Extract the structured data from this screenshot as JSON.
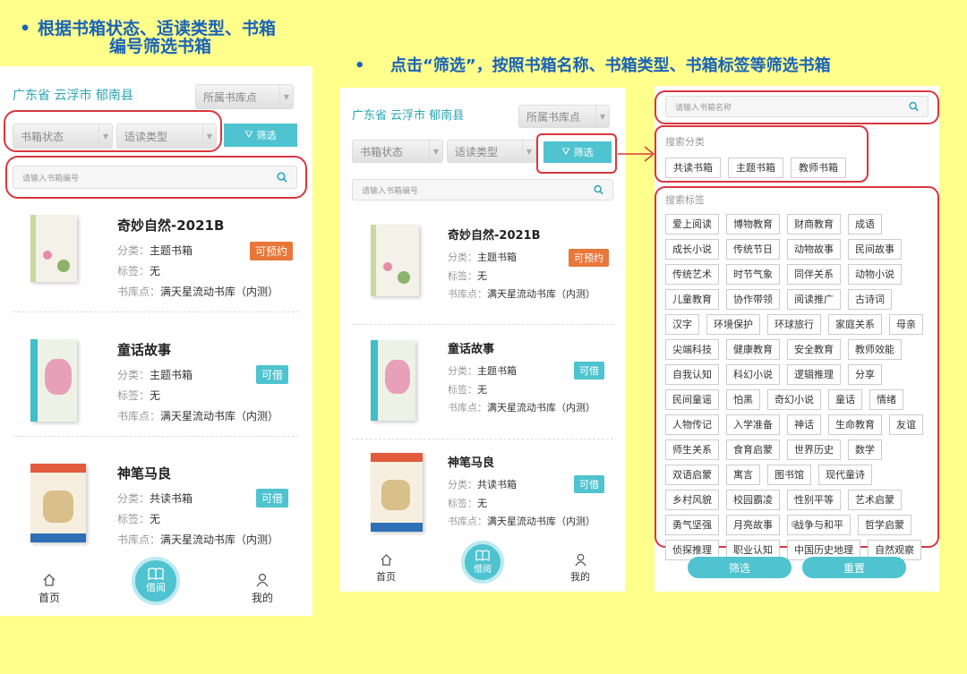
{
  "caption_left": [
    "根据书箱状态、适读类型、书箱",
    "编号筛选书箱"
  ],
  "caption_right": "点击“筛选”，按照书箱名称、书箱类型、书箱标签等筛选书箱",
  "bullet": "•",
  "location": "广东省 云浮市 郁南县",
  "library_point": "所属书库点",
  "status_select": "书箱状态",
  "type_select": "适读类型",
  "filter_btn": "筛选",
  "box_no_placeholder": "请输入书箱编号",
  "labels": {
    "category": "分类：",
    "tag": "标签：",
    "library": "书库点："
  },
  "books": [
    {
      "title": "奇妙自然-2021B",
      "category": "主题书箱",
      "tag": "无",
      "library": "满天星流动书库（内测）",
      "status": "可预约",
      "status_color": "#e8773a"
    },
    {
      "title": "童话故事",
      "category": "主题书箱",
      "tag": "无",
      "library": "满天星流动书库（内测）",
      "status": "可借",
      "status_color": "#4fc3cf"
    },
    {
      "title": "神笔马良",
      "category": "共读书箱",
      "tag": "无",
      "library": "满天星流动书库（内测）",
      "status": "可借",
      "status_color": "#4fc3cf"
    }
  ],
  "nav": {
    "home": "首页",
    "borrow": "借阅",
    "mine": "我的"
  },
  "filter_panel": {
    "name_placeholder": "请输入书箱名称",
    "category_title": "搜索分类",
    "categories": [
      "共读书箱",
      "主题书箱",
      "教师书箱"
    ],
    "tag_title": "搜索标签",
    "tag_rows": [
      [
        "爱上阅读",
        "博物教育",
        "财商教育",
        "成语"
      ],
      [
        "成长小说",
        "传统节日",
        "动物故事",
        "民间故事"
      ],
      [
        "传统艺术",
        "时节气象",
        "同伴关系",
        "动物小说"
      ],
      [
        "儿童教育",
        "协作带领",
        "阅读推广",
        "古诗词"
      ],
      [
        "汉字",
        "环境保护",
        "环球旅行",
        "家庭关系",
        "母亲"
      ],
      [
        "尖端科技",
        "健康教育",
        "安全教育",
        "教师效能"
      ],
      [
        "自我认知",
        "科幻小说",
        "逻辑推理",
        "分享"
      ],
      [
        "民间童谣",
        "怕黑",
        "奇幻小说",
        "童话",
        "情绪"
      ],
      [
        "人物传记",
        "入学准备",
        "神话",
        "生命教育",
        "友谊"
      ],
      [
        "师生关系",
        "食育启蒙",
        "世界历史",
        "数学"
      ],
      [
        "双语启蒙",
        "寓言",
        "图书馆",
        "现代童诗"
      ],
      [
        "乡村风貌",
        "校园霸凌",
        "性别平等",
        "艺术启蒙"
      ],
      [
        "勇气坚强",
        "月亮故事",
        "战争与和平",
        "哲学启蒙"
      ],
      [
        "侦探推理",
        "职业认知",
        "中国历史地理",
        "自然观察"
      ]
    ],
    "filter_btn": "筛选",
    "reset_btn": "重置"
  },
  "colors": {
    "accent": "#4fc3cf",
    "highlight": "#d9363e",
    "caption": "#1a63b8",
    "background": "#ffff8c"
  }
}
